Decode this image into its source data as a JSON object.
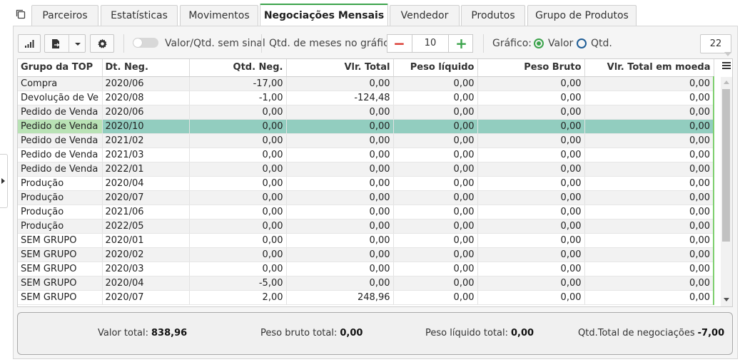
{
  "tabs": [
    {
      "label": "Parceiros"
    },
    {
      "label": "Estatísticas"
    },
    {
      "label": "Movimentos"
    },
    {
      "label": "Negociações Mensais",
      "active": true
    },
    {
      "label": "Vendedor"
    },
    {
      "label": "Produtos"
    },
    {
      "label": "Grupo de Produtos"
    }
  ],
  "toolbar": {
    "toggle_label": "Valor/Qtd. sem sinal",
    "months_label": "Qtd. de meses no gráfico:",
    "months_value": "10",
    "minus_symbol": "−",
    "plus_symbol": "+",
    "chart_label": "Gráfico:",
    "radio_valor": "Valor",
    "radio_qtd": "Qtd.",
    "count": "22",
    "icons": [
      "bar-chart-icon",
      "export-icon",
      "dropdown-icon",
      "gear-icon"
    ]
  },
  "grid": {
    "columns": [
      "Grupo da TOP",
      "Dt. Neg.",
      "Qtd. Neg.",
      "Vlr. Total",
      "Peso líquido",
      "Peso Bruto",
      "Vlr. Total em moeda"
    ],
    "rows": [
      [
        "Compra",
        "2020/06",
        "-17,00",
        "0,00",
        "0,00",
        "0,00",
        "0,00"
      ],
      [
        "Devolução de Ve",
        "2020/08",
        "-1,00",
        "-124,48",
        "0,00",
        "0,00",
        "0,00"
      ],
      [
        "Pedido de Venda",
        "2020/06",
        "0,00",
        "0,00",
        "0,00",
        "0,00",
        "0,00"
      ],
      [
        "Pedido de Venda",
        "2020/10",
        "0,00",
        "0,00",
        "0,00",
        "0,00",
        "0,00"
      ],
      [
        "Pedido de Venda",
        "2021/02",
        "0,00",
        "0,00",
        "0,00",
        "0,00",
        "0,00"
      ],
      [
        "Pedido de Venda",
        "2021/03",
        "0,00",
        "0,00",
        "0,00",
        "0,00",
        "0,00"
      ],
      [
        "Pedido de Venda",
        "2022/01",
        "0,00",
        "0,00",
        "0,00",
        "0,00",
        "0,00"
      ],
      [
        "Produção",
        "2020/04",
        "0,00",
        "0,00",
        "0,00",
        "0,00",
        "0,00"
      ],
      [
        "Produção",
        "2020/07",
        "0,00",
        "0,00",
        "0,00",
        "0,00",
        "0,00"
      ],
      [
        "Produção",
        "2021/06",
        "0,00",
        "0,00",
        "0,00",
        "0,00",
        "0,00"
      ],
      [
        "Produção",
        "2022/05",
        "0,00",
        "0,00",
        "0,00",
        "0,00",
        "0,00"
      ],
      [
        "SEM GRUPO",
        "2020/01",
        "0,00",
        "0,00",
        "0,00",
        "0,00",
        "0,00"
      ],
      [
        "SEM GRUPO",
        "2020/02",
        "0,00",
        "0,00",
        "0,00",
        "0,00",
        "0,00"
      ],
      [
        "SEM GRUPO",
        "2020/03",
        "0,00",
        "0,00",
        "0,00",
        "0,00",
        "0,00"
      ],
      [
        "SEM GRUPO",
        "2020/04",
        "-5,00",
        "0,00",
        "0,00",
        "0,00",
        "0,00"
      ],
      [
        "SEM GRUPO",
        "2020/07",
        "2,00",
        "248,96",
        "0,00",
        "0,00",
        "0,00"
      ]
    ],
    "selected_row": 3
  },
  "totals": {
    "valor_label": "Valor total:",
    "valor": "838,96",
    "peso_bruto_label": "Peso bruto total:",
    "peso_bruto": "0,00",
    "peso_liquido_label": "Peso líquido total:",
    "peso_liquido": "0,00",
    "qtd_label": "Qtd.Total de negociações",
    "qtd": "-7,00"
  },
  "colors": {
    "accent_green": "#3ba34b",
    "selected_row": "#92cdbf",
    "minus_red": "#d9342b",
    "plus_green": "#3ba34b"
  }
}
